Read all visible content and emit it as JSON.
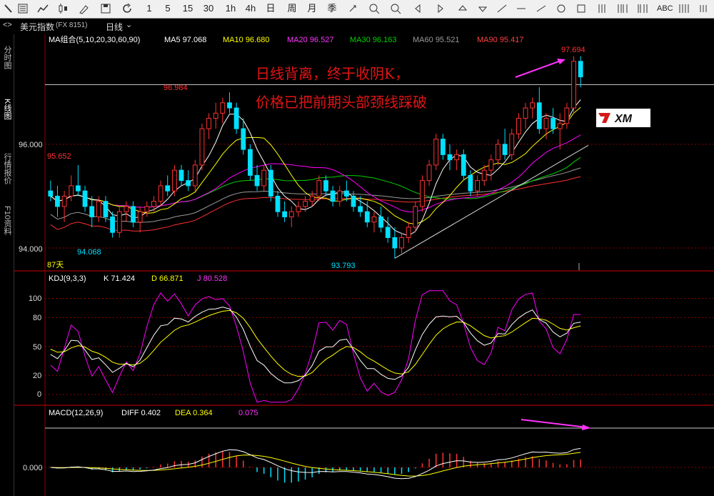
{
  "toolbar": {
    "items": [
      "1",
      "5",
      "15",
      "30",
      "1h",
      "4h",
      "日",
      "周",
      "月",
      "季"
    ],
    "abc_label": "ABC"
  },
  "instrument": {
    "name": "美元指数",
    "code": "(FX 8151)",
    "period": "日线"
  },
  "side_tabs": [
    "分时图",
    "K线图",
    "行情报价",
    "F10资料"
  ],
  "colors": {
    "up": "#ff3232",
    "down": "#00e0ff",
    "grid": "#8b0000",
    "ma5": "#ffffff",
    "ma10": "#ffff00",
    "ma20": "#ff00ff",
    "ma30": "#00d000",
    "ma60": "#9a9a9a",
    "ma90": "#ff3030",
    "annotation": "#e11414",
    "arrow": "#ff33ff"
  },
  "chart_data": [
    {
      "type": "candlestick",
      "panel": "main",
      "legend_title": "MA组合(5,10,20,30,60,90)",
      "legend": [
        {
          "name": "MA5",
          "value": "97.068"
        },
        {
          "name": "MA10",
          "value": "96.680"
        },
        {
          "name": "MA20",
          "value": "96.527"
        },
        {
          "name": "MA30",
          "value": "96.163"
        },
        {
          "name": "MA60",
          "value": "95.521"
        },
        {
          "name": "MA90",
          "value": "95.417"
        }
      ],
      "ytick_labels": [
        "96.000",
        "94.000"
      ],
      "yticks": [
        96.0,
        94.0
      ],
      "ylim": [
        93.6,
        97.9
      ],
      "annotations": {
        "high_label": "96.984",
        "left_label": "95.652",
        "low_label_1": "94.068",
        "low_label_2": "93.793",
        "peak_label": "97.694",
        "days_label": "87天"
      },
      "note_lines": [
        "日线背离，终于收阴K，",
        "价格已把前期头部颈线踩破"
      ],
      "ohlc": [
        [
          95.1,
          95.3,
          94.9,
          95.0
        ],
        [
          95.0,
          95.2,
          94.6,
          94.8
        ],
        [
          94.8,
          95.1,
          94.5,
          95.0
        ],
        [
          95.0,
          95.4,
          94.9,
          95.2
        ],
        [
          95.2,
          95.6,
          95.0,
          95.1
        ],
        [
          95.1,
          95.2,
          94.7,
          94.8
        ],
        [
          94.8,
          95.0,
          94.4,
          94.6
        ],
        [
          94.6,
          95.0,
          94.5,
          94.9
        ],
        [
          94.9,
          95.0,
          94.5,
          94.6
        ],
        [
          94.6,
          94.7,
          94.2,
          94.3
        ],
        [
          94.3,
          94.8,
          94.2,
          94.7
        ],
        [
          94.7,
          94.9,
          94.5,
          94.8
        ],
        [
          94.8,
          94.9,
          94.4,
          94.5
        ],
        [
          94.5,
          94.8,
          94.3,
          94.7
        ],
        [
          94.7,
          94.9,
          94.6,
          94.8
        ],
        [
          94.8,
          95.0,
          94.7,
          94.9
        ],
        [
          94.9,
          95.3,
          94.8,
          95.2
        ],
        [
          95.2,
          95.4,
          95.0,
          95.1
        ],
        [
          95.1,
          95.6,
          95.0,
          95.5
        ],
        [
          95.5,
          95.6,
          95.2,
          95.3
        ],
        [
          95.3,
          95.5,
          95.1,
          95.2
        ],
        [
          95.2,
          95.7,
          95.1,
          95.6
        ],
        [
          95.6,
          96.4,
          95.5,
          96.3
        ],
        [
          96.3,
          96.6,
          96.1,
          96.5
        ],
        [
          96.5,
          96.8,
          96.3,
          96.6
        ],
        [
          96.6,
          96.9,
          96.4,
          96.8
        ],
        [
          96.8,
          97.0,
          96.6,
          96.7
        ],
        [
          96.7,
          96.8,
          96.2,
          96.3
        ],
        [
          96.3,
          96.5,
          95.8,
          95.9
        ],
        [
          95.9,
          96.0,
          95.3,
          95.4
        ],
        [
          95.4,
          95.6,
          95.1,
          95.2
        ],
        [
          95.2,
          95.6,
          95.1,
          95.5
        ],
        [
          95.5,
          95.6,
          94.9,
          95.0
        ],
        [
          95.0,
          95.1,
          94.6,
          94.7
        ],
        [
          94.7,
          94.9,
          94.5,
          94.6
        ],
        [
          94.6,
          94.8,
          94.4,
          94.7
        ],
        [
          94.7,
          94.9,
          94.6,
          94.8
        ],
        [
          94.8,
          95.0,
          94.7,
          94.9
        ],
        [
          94.9,
          95.1,
          94.8,
          95.0
        ],
        [
          95.0,
          95.4,
          94.9,
          95.3
        ],
        [
          95.3,
          95.4,
          95.0,
          95.1
        ],
        [
          95.1,
          95.2,
          94.8,
          94.9
        ],
        [
          94.9,
          95.2,
          94.8,
          95.1
        ],
        [
          95.1,
          95.3,
          94.9,
          95.0
        ],
        [
          95.0,
          95.1,
          94.7,
          94.8
        ],
        [
          94.8,
          95.0,
          94.6,
          94.7
        ],
        [
          94.7,
          94.9,
          94.4,
          94.5
        ],
        [
          94.5,
          94.7,
          94.3,
          94.6
        ],
        [
          94.6,
          94.8,
          94.3,
          94.4
        ],
        [
          94.4,
          94.6,
          94.1,
          94.2
        ],
        [
          94.2,
          94.4,
          93.8,
          94.0
        ],
        [
          94.0,
          94.3,
          93.9,
          94.2
        ],
        [
          94.2,
          94.5,
          94.1,
          94.4
        ],
        [
          94.4,
          94.9,
          94.3,
          94.8
        ],
        [
          94.8,
          95.4,
          94.7,
          95.3
        ],
        [
          95.3,
          95.7,
          95.2,
          95.6
        ],
        [
          95.6,
          96.2,
          95.5,
          96.1
        ],
        [
          96.1,
          96.2,
          95.7,
          95.8
        ],
        [
          95.8,
          96.0,
          95.5,
          95.7
        ],
        [
          95.7,
          95.9,
          95.5,
          95.8
        ],
        [
          95.8,
          95.9,
          95.3,
          95.4
        ],
        [
          95.4,
          95.5,
          95.0,
          95.1
        ],
        [
          95.1,
          95.4,
          95.0,
          95.3
        ],
        [
          95.3,
          95.6,
          95.2,
          95.5
        ],
        [
          95.5,
          95.8,
          95.3,
          95.7
        ],
        [
          95.7,
          96.1,
          95.6,
          96.0
        ],
        [
          96.0,
          96.3,
          95.7,
          95.8
        ],
        [
          95.8,
          96.3,
          95.7,
          96.2
        ],
        [
          96.2,
          96.6,
          96.1,
          96.5
        ],
        [
          96.5,
          96.8,
          96.3,
          96.7
        ],
        [
          96.7,
          96.9,
          96.5,
          96.8
        ],
        [
          96.8,
          97.1,
          96.2,
          96.3
        ],
        [
          96.3,
          96.6,
          96.1,
          96.5
        ],
        [
          96.5,
          96.7,
          96.2,
          96.3
        ],
        [
          96.3,
          96.6,
          95.9,
          96.4
        ],
        [
          96.4,
          96.8,
          96.3,
          96.7
        ],
        [
          96.7,
          97.7,
          96.6,
          97.6
        ],
        [
          97.6,
          97.7,
          97.1,
          97.3
        ]
      ]
    },
    {
      "type": "line",
      "panel": "kdj",
      "legend_title": "KDJ(9,3,3)",
      "legend": [
        {
          "name": "K",
          "value": "71.424"
        },
        {
          "name": "D",
          "value": "66.871"
        },
        {
          "name": "J",
          "value": "80.528"
        }
      ],
      "yticks": [
        100,
        80,
        50,
        20,
        0
      ],
      "ytick_labels": [
        "100",
        "80",
        "50",
        "20",
        "0"
      ]
    },
    {
      "type": "bar",
      "panel": "macd",
      "legend_title": "MACD(12,26,9)",
      "legend": [
        {
          "name": "DIFF",
          "value": "0.402"
        },
        {
          "name": "DEA",
          "value": "0.364"
        },
        {
          "name": "MACD",
          "value": "0.075"
        }
      ],
      "ytick_labels": [
        "0.000"
      ],
      "yticks": [
        0
      ]
    }
  ]
}
